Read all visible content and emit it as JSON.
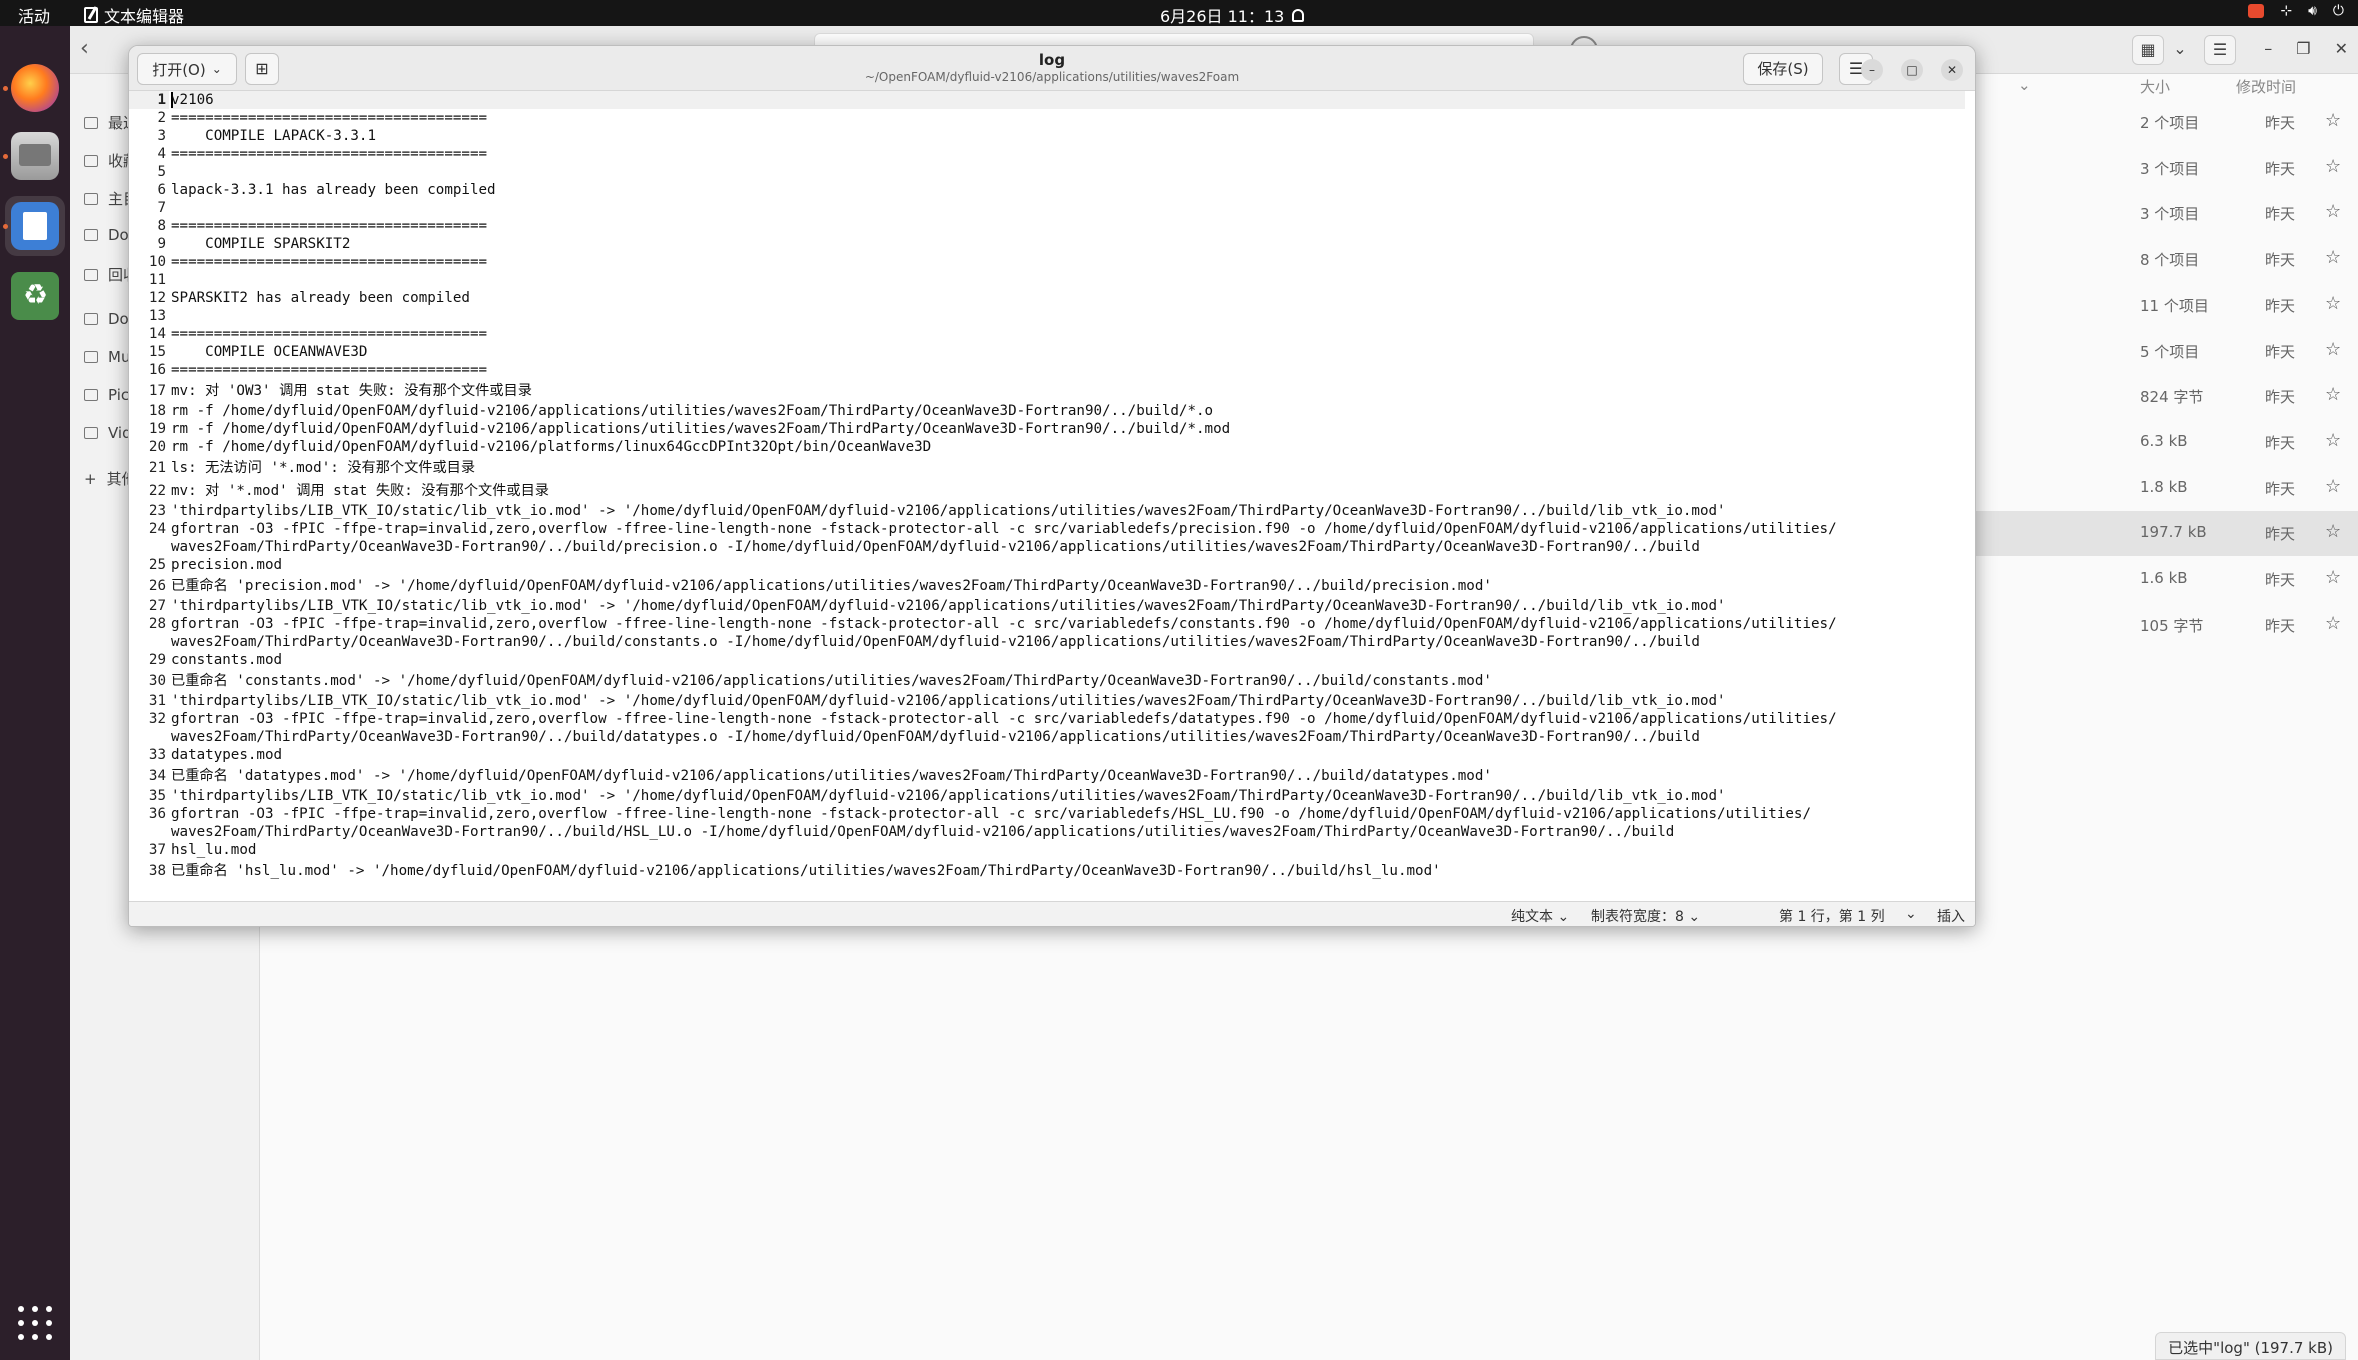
{
  "topbar": {
    "activities": "活动",
    "app_name": "文本编辑器",
    "clock": "6月26日 11：13"
  },
  "file_manager": {
    "sidebar": [
      "最近",
      "收藏",
      "主目录",
      "Downloads",
      "回收站",
      "Documents",
      "Music",
      "Pictures",
      "Videos",
      "其他位置"
    ],
    "columns": {
      "size": "大小",
      "modified": "修改时间"
    },
    "rows": [
      {
        "size": "2 个项目",
        "time": "昨天"
      },
      {
        "size": "3 个项目",
        "time": "昨天"
      },
      {
        "size": "3 个项目",
        "time": "昨天"
      },
      {
        "size": "8 个项目",
        "time": "昨天"
      },
      {
        "size": "11 个项目",
        "time": "昨天"
      },
      {
        "size": "5 个项目",
        "time": "昨天"
      },
      {
        "size": "824 字节",
        "time": "昨天"
      },
      {
        "size": "6.3 kB",
        "time": "昨天"
      },
      {
        "size": "1.8 kB",
        "time": "昨天"
      },
      {
        "size": "197.7 kB",
        "time": "昨天"
      },
      {
        "size": "1.6 kB",
        "time": "昨天"
      },
      {
        "size": "105 字节",
        "time": "昨天"
      }
    ],
    "status": "已选中\"log\" (197.7 kB)"
  },
  "editor": {
    "open_label": "打开(O)",
    "title": "log",
    "subtitle": "~/OpenFOAM/dyfluid-v2106/applications/utilities/waves2Foam",
    "save_label": "保存(S)",
    "status": {
      "lang": "纯文本",
      "tab": "制表符宽度：8",
      "pos": "第 1 行，第 1 列",
      "mode": "插入"
    },
    "lines": [
      "v2106",
      "=====================================",
      "    COMPILE LAPACK-3.3.1",
      "=====================================",
      "",
      "lapack-3.3.1 has already been compiled",
      "",
      "=====================================",
      "    COMPILE SPARSKIT2",
      "=====================================",
      "",
      "SPARSKIT2 has already been compiled",
      "",
      "=====================================",
      "    COMPILE OCEANWAVE3D",
      "=====================================",
      "mv: 对 'OW3' 调用 stat 失败: 没有那个文件或目录",
      "rm -f /home/dyfluid/OpenFOAM/dyfluid-v2106/applications/utilities/waves2Foam/ThirdParty/OceanWave3D-Fortran90/../build/*.o",
      "rm -f /home/dyfluid/OpenFOAM/dyfluid-v2106/applications/utilities/waves2Foam/ThirdParty/OceanWave3D-Fortran90/../build/*.mod",
      "rm -f /home/dyfluid/OpenFOAM/dyfluid-v2106/platforms/linux64GccDPInt32Opt/bin/OceanWave3D",
      "ls: 无法访问 '*.mod': 没有那个文件或目录",
      "mv: 对 '*.mod' 调用 stat 失败: 没有那个文件或目录",
      "'thirdpartylibs/LIB_VTK_IO/static/lib_vtk_io.mod' -> '/home/dyfluid/OpenFOAM/dyfluid-v2106/applications/utilities/waves2Foam/ThirdParty/OceanWave3D-Fortran90/../build/lib_vtk_io.mod'",
      "gfortran -O3 -fPIC -ffpe-trap=invalid,zero,overflow -ffree-line-length-none -fstack-protector-all -c src/variabledefs/precision.f90 -o /home/dyfluid/OpenFOAM/dyfluid-v2106/applications/utilities/\nwaves2Foam/ThirdParty/OceanWave3D-Fortran90/../build/precision.o -I/home/dyfluid/OpenFOAM/dyfluid-v2106/applications/utilities/waves2Foam/ThirdParty/OceanWave3D-Fortran90/../build",
      "precision.mod",
      "已重命名 'precision.mod' -> '/home/dyfluid/OpenFOAM/dyfluid-v2106/applications/utilities/waves2Foam/ThirdParty/OceanWave3D-Fortran90/../build/precision.mod'",
      "'thirdpartylibs/LIB_VTK_IO/static/lib_vtk_io.mod' -> '/home/dyfluid/OpenFOAM/dyfluid-v2106/applications/utilities/waves2Foam/ThirdParty/OceanWave3D-Fortran90/../build/lib_vtk_io.mod'",
      "gfortran -O3 -fPIC -ffpe-trap=invalid,zero,overflow -ffree-line-length-none -fstack-protector-all -c src/variabledefs/constants.f90 -o /home/dyfluid/OpenFOAM/dyfluid-v2106/applications/utilities/\nwaves2Foam/ThirdParty/OceanWave3D-Fortran90/../build/constants.o -I/home/dyfluid/OpenFOAM/dyfluid-v2106/applications/utilities/waves2Foam/ThirdParty/OceanWave3D-Fortran90/../build",
      "constants.mod",
      "已重命名 'constants.mod' -> '/home/dyfluid/OpenFOAM/dyfluid-v2106/applications/utilities/waves2Foam/ThirdParty/OceanWave3D-Fortran90/../build/constants.mod'",
      "'thirdpartylibs/LIB_VTK_IO/static/lib_vtk_io.mod' -> '/home/dyfluid/OpenFOAM/dyfluid-v2106/applications/utilities/waves2Foam/ThirdParty/OceanWave3D-Fortran90/../build/lib_vtk_io.mod'",
      "gfortran -O3 -fPIC -ffpe-trap=invalid,zero,overflow -ffree-line-length-none -fstack-protector-all -c src/variabledefs/datatypes.f90 -o /home/dyfluid/OpenFOAM/dyfluid-v2106/applications/utilities/\nwaves2Foam/ThirdParty/OceanWave3D-Fortran90/../build/datatypes.o -I/home/dyfluid/OpenFOAM/dyfluid-v2106/applications/utilities/waves2Foam/ThirdParty/OceanWave3D-Fortran90/../build",
      "datatypes.mod",
      "已重命名 'datatypes.mod' -> '/home/dyfluid/OpenFOAM/dyfluid-v2106/applications/utilities/waves2Foam/ThirdParty/OceanWave3D-Fortran90/../build/datatypes.mod'",
      "'thirdpartylibs/LIB_VTK_IO/static/lib_vtk_io.mod' -> '/home/dyfluid/OpenFOAM/dyfluid-v2106/applications/utilities/waves2Foam/ThirdParty/OceanWave3D-Fortran90/../build/lib_vtk_io.mod'",
      "gfortran -O3 -fPIC -ffpe-trap=invalid,zero,overflow -ffree-line-length-none -fstack-protector-all -c src/variabledefs/HSL_LU.f90 -o /home/dyfluid/OpenFOAM/dyfluid-v2106/applications/utilities/\nwaves2Foam/ThirdParty/OceanWave3D-Fortran90/../build/HSL_LU.o -I/home/dyfluid/OpenFOAM/dyfluid-v2106/applications/utilities/waves2Foam/ThirdParty/OceanWave3D-Fortran90/../build",
      "hsl_lu.mod",
      "已重命名 'hsl_lu.mod' -> '/home/dyfluid/OpenFOAM/dyfluid-v2106/applications/utilities/waves2Foam/ThirdParty/OceanWave3D-Fortran90/../build/hsl_lu.mod'"
    ]
  }
}
